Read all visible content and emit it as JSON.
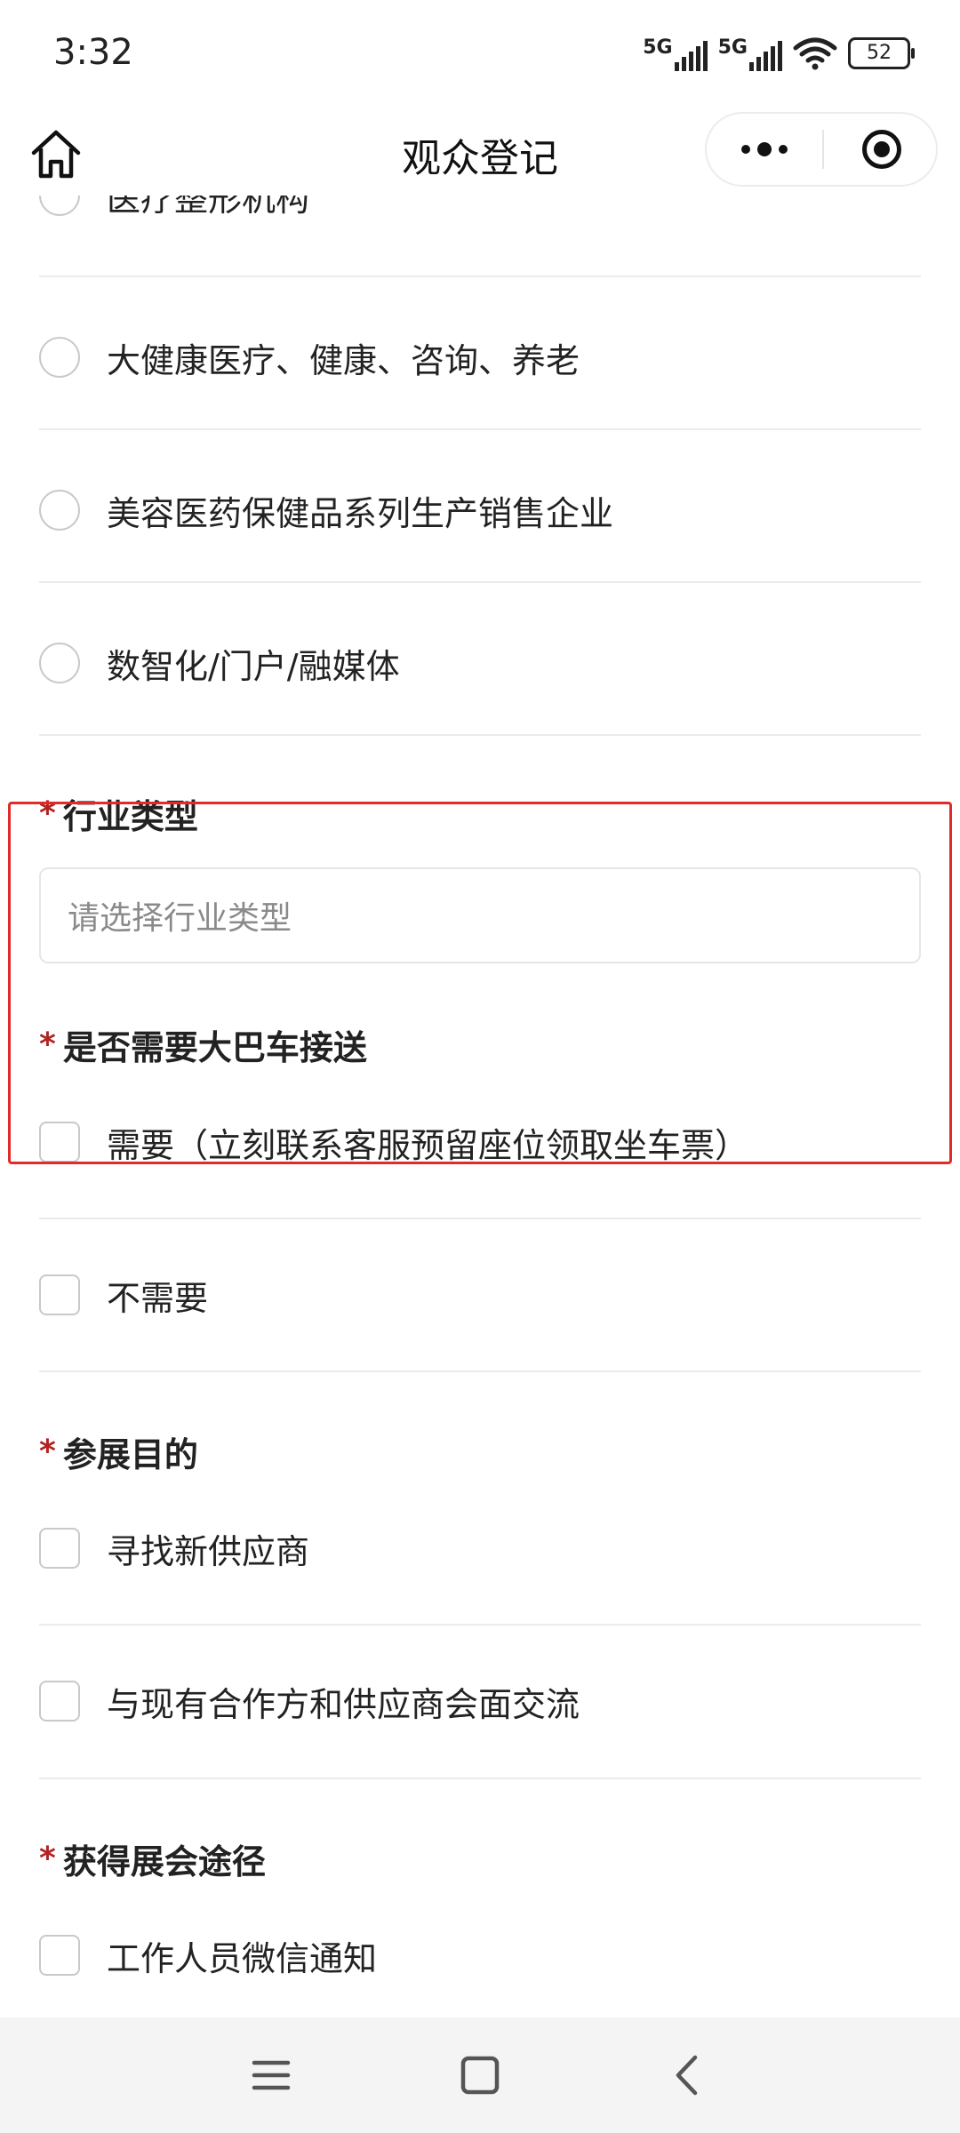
{
  "status_bar": {
    "time": "3:32",
    "network1": "5G",
    "network2": "5G",
    "battery": "52"
  },
  "nav": {
    "title": "观众登记"
  },
  "options_top": [
    {
      "label": "医疗整形机构"
    },
    {
      "label": "大健康医疗、健康、咨询、养老"
    },
    {
      "label": "美容医药保健品系列生产销售企业"
    },
    {
      "label": "数智化/门户/融媒体"
    }
  ],
  "industry": {
    "required_mark": "*",
    "title": "行业类型",
    "placeholder": "请选择行业类型"
  },
  "bus": {
    "required_mark": "*",
    "title": "是否需要大巴车接送",
    "options": [
      {
        "label": "需要（立刻联系客服预留座位领取坐车票）"
      },
      {
        "label": "不需要"
      }
    ]
  },
  "purpose": {
    "required_mark": "*",
    "title": "参展目的",
    "options": [
      {
        "label": "寻找新供应商"
      },
      {
        "label": "与现有合作方和供应商会面交流"
      }
    ]
  },
  "channel": {
    "required_mark": "*",
    "title": "获得展会途径",
    "options": [
      {
        "label": "工作人员微信通知"
      }
    ]
  },
  "colors": {
    "required": "#b32222",
    "highlight_border": "#e02b2b",
    "text": "#222222",
    "placeholder": "#8a8a8a"
  }
}
